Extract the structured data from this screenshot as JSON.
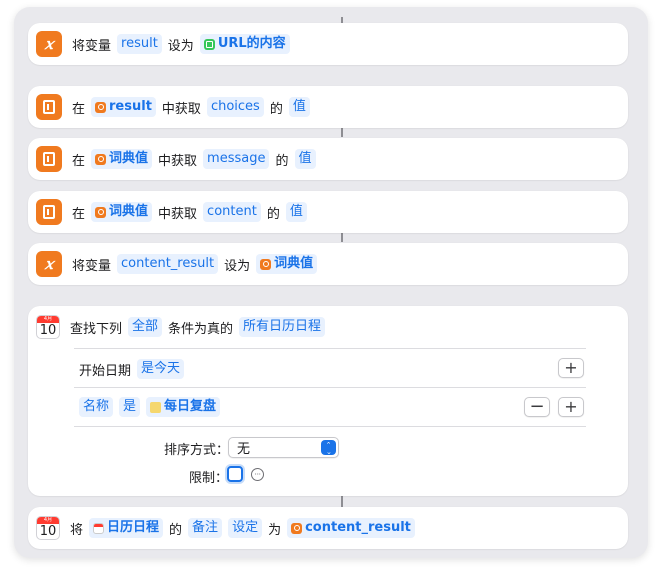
{
  "actions": [
    {
      "prefix": "将变量",
      "var": "result",
      "mid": "设为",
      "magic": "URL的内容"
    },
    {
      "pre": "在",
      "magic": "result",
      "mid1": "中获取",
      "key": "choices",
      "mid2": "的",
      "val": "值"
    },
    {
      "pre": "在",
      "magic": "词典值",
      "mid1": "中获取",
      "key": "message",
      "mid2": "的",
      "val": "值"
    },
    {
      "pre": "在",
      "magic": "词典值",
      "mid1": "中获取",
      "key": "content",
      "mid2": "的",
      "val": "值"
    },
    {
      "prefix": "将变量",
      "var": "content_result",
      "mid": "设为",
      "magic": "词典值"
    }
  ],
  "find": {
    "title": "查找下列",
    "scope": "全部",
    "mid": "条件为真的",
    "target": "所有日历日程",
    "cal_month": "4月",
    "cal_day": "10",
    "cond1": {
      "field": "开始日期",
      "op": "是今天"
    },
    "cond2": {
      "field": "名称",
      "op": "是",
      "value": "每日复盘"
    },
    "sort_label": "排序方式：",
    "sort_value": "无",
    "limit_label": "限制：",
    "plus": "+",
    "minus": "−"
  },
  "set_note": {
    "pre": "将",
    "magic": "日历日程",
    "mid1": "的",
    "field": "备注",
    "op": "设定",
    "mid2": "为",
    "value": "content_result",
    "cal_month": "4月",
    "cal_day": "10"
  },
  "icons": {
    "variable": "x-variable-icon",
    "dictionary": "dictionary-icon",
    "calendar": "calendar-icon"
  },
  "colors": {
    "token_text": "#1a73e8",
    "token_bg": "#e8f1fe",
    "action_orange": "#f07a1f"
  }
}
